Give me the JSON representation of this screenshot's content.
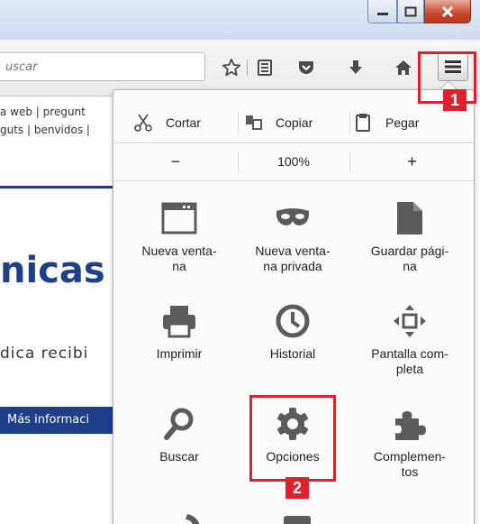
{
  "toolbar": {
    "search_placeholder": "uscar"
  },
  "page_background": {
    "links_line1": "a web  | pregunt",
    "links_line2": "guts | benvidos |",
    "heading": "nicas",
    "subtext": "dica recibi",
    "button": "Más informaci"
  },
  "menu": {
    "edit": {
      "cut": "Cortar",
      "copy": "Copiar",
      "paste": "Pegar"
    },
    "zoom": {
      "minus": "−",
      "level": "100%",
      "plus": "+"
    },
    "tiles": [
      {
        "label": "Nueva venta-\nna",
        "icon": "window-icon"
      },
      {
        "label": "Nueva venta-\nna privada",
        "icon": "mask-icon"
      },
      {
        "label": "Guardar pági-\nna",
        "icon": "page-icon"
      },
      {
        "label": "Imprimir",
        "icon": "printer-icon"
      },
      {
        "label": "Historial",
        "icon": "clock-icon"
      },
      {
        "label": "Pantalla com-\npleta",
        "icon": "fullscreen-icon"
      },
      {
        "label": "Buscar",
        "icon": "magnifier-icon"
      },
      {
        "label": "Opciones",
        "icon": "gear-icon"
      },
      {
        "label": "Complemen-\ntos",
        "icon": "puzzle-icon"
      }
    ]
  },
  "annotations": {
    "badge_1": "1",
    "badge_2": "2",
    "highlight_color": "#e0202c"
  },
  "colors": {
    "icon_gray": "#5b5b5b",
    "brand_blue": "#1e3f8a"
  }
}
